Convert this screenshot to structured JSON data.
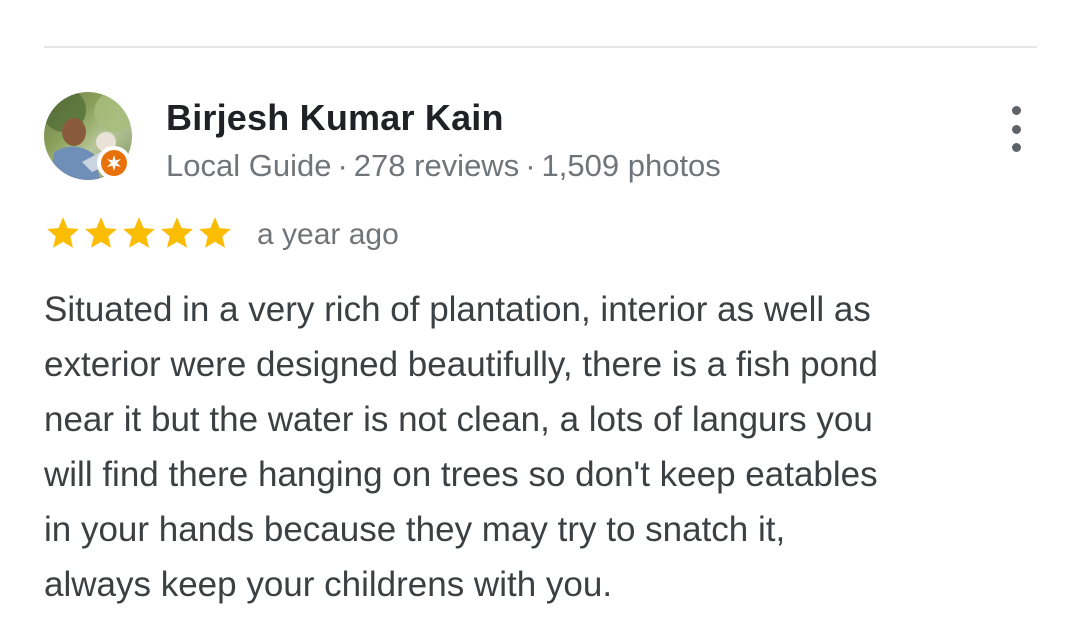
{
  "reviewer": {
    "name": "Birjesh Kumar Kain",
    "level": "Local Guide",
    "reviews": "278 reviews",
    "photos": "1,509 photos",
    "separator": "·"
  },
  "rating": {
    "stars": 5,
    "max": 5,
    "time": "a year ago"
  },
  "review": {
    "lines": [
      "Situated in a very rich of plantation, interior as well as",
      "exterior were designed beautifully, there is a fish pond",
      "near it but the water is not clean, a lots of langurs you",
      "will find there hanging on trees so don't keep eatables",
      "in your hands because they may try to snatch it,",
      "always keep your childrens with you."
    ]
  },
  "colors": {
    "star": "#fbbc04",
    "badge": "#e8710a",
    "name": "#202124",
    "meta": "#70757a",
    "body": "#3c4043"
  },
  "icons": {
    "more": "more-vert-icon",
    "star": "star-icon",
    "badge": "local-guide-badge-icon"
  }
}
